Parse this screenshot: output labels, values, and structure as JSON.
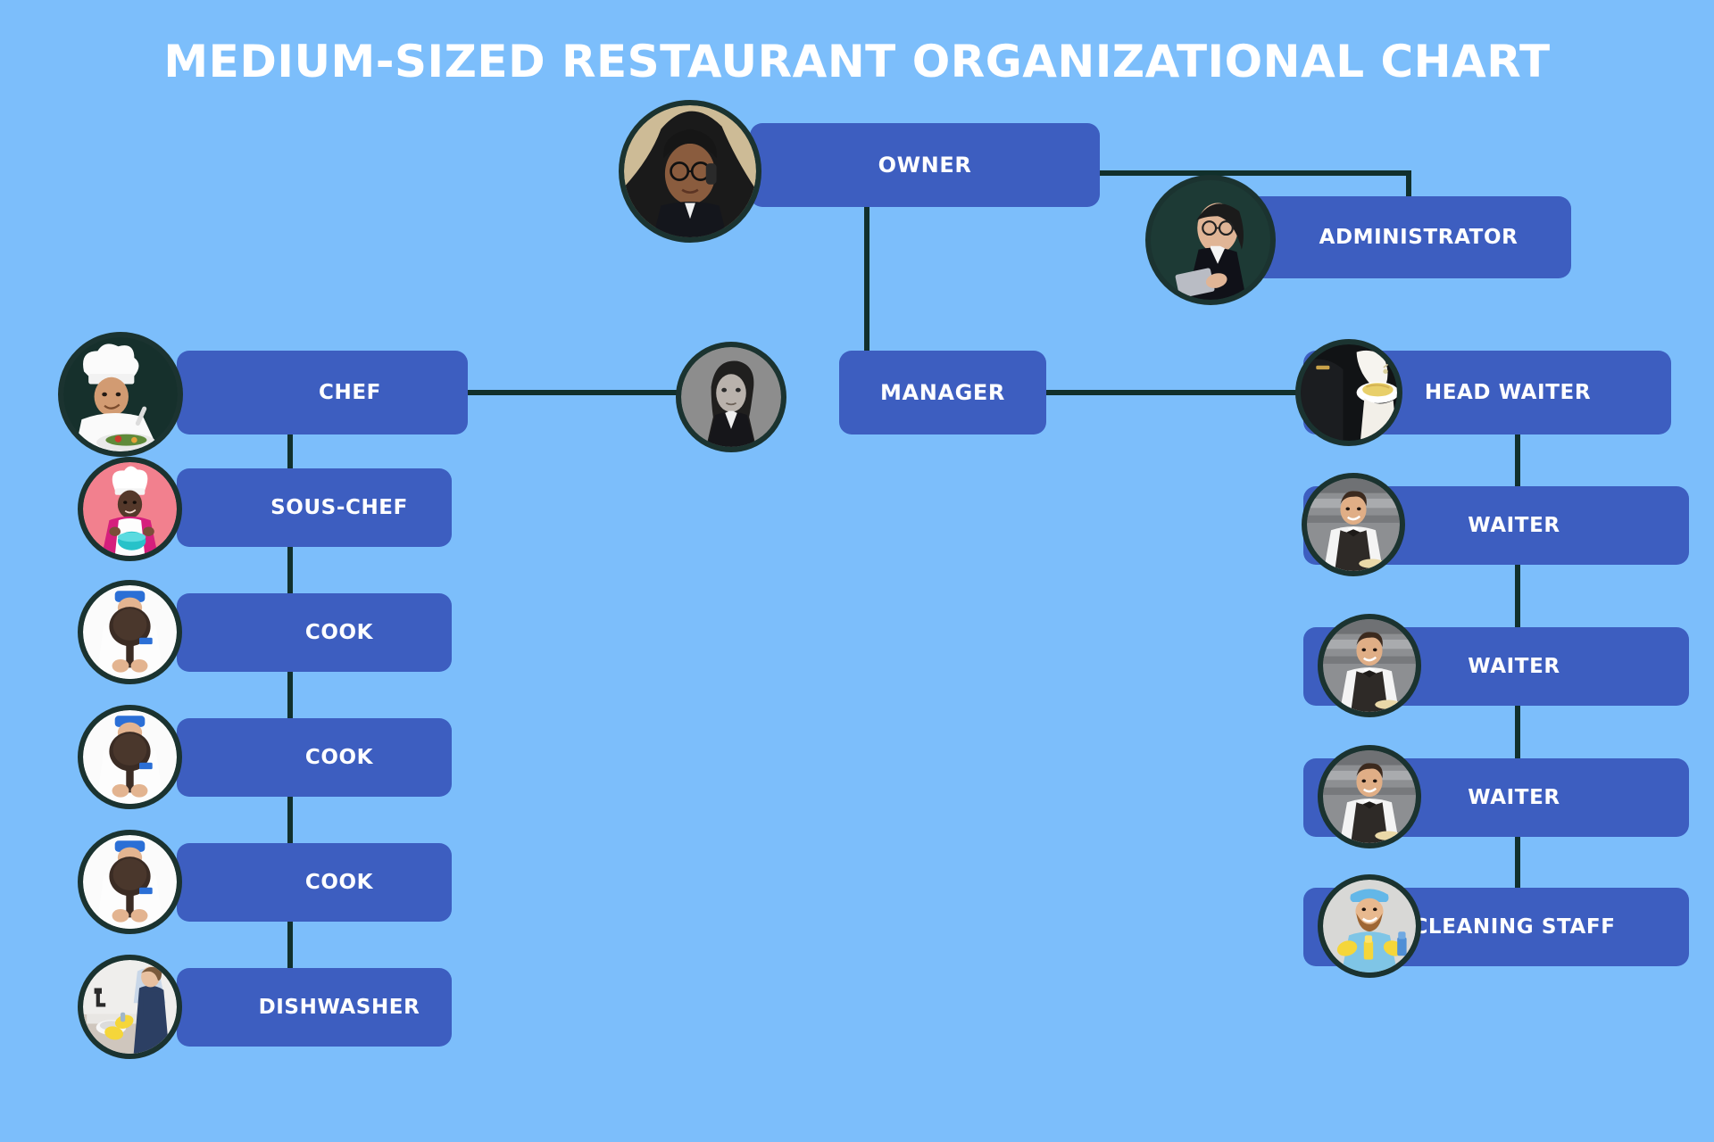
{
  "title": "MEDIUM-SIZED RESTAURANT ORGANIZATIONAL CHART",
  "colors": {
    "background": "#7cbefb",
    "node_fill": "#3d5ec0",
    "connector": "#11302c",
    "label_text": "#ffffff",
    "avatar_ring": "#1b3330"
  },
  "chart_data": {
    "type": "diagram",
    "diagram_kind": "organizational-chart",
    "title": "MEDIUM-SIZED RESTAURANT ORGANIZATIONAL CHART",
    "nodes": [
      {
        "id": "owner",
        "label": "OWNER",
        "level": 0,
        "avatar": "woman-curly-hair-glasses-phone-portrait"
      },
      {
        "id": "administrator",
        "label": "ADMINISTRATOR",
        "level": 1,
        "avatar": "woman-glasses-tablet-portrait"
      },
      {
        "id": "manager",
        "label": "MANAGER",
        "level": 1,
        "avatar": "woman-dark-hair-blazer-bw-portrait"
      },
      {
        "id": "chef",
        "label": "CHEF",
        "level": 2,
        "avatar": "chef-white-hat-plating-dish"
      },
      {
        "id": "sous-chef",
        "label": "SOUS-CHEF",
        "level": 3,
        "avatar": "chef-pink-background-bowl"
      },
      {
        "id": "cook-1",
        "label": "COOK",
        "level": 3,
        "avatar": "cook-holding-frying-pan"
      },
      {
        "id": "cook-2",
        "label": "COOK",
        "level": 3,
        "avatar": "cook-holding-frying-pan"
      },
      {
        "id": "cook-3",
        "label": "COOK",
        "level": 3,
        "avatar": "cook-holding-frying-pan"
      },
      {
        "id": "dishwasher",
        "label": "DISHWASHER",
        "level": 3,
        "avatar": "person-yellow-gloves-washing-sink"
      },
      {
        "id": "head-waiter",
        "label": "HEAD WAITER",
        "level": 2,
        "avatar": "waiter-dark-suit-serving-plate"
      },
      {
        "id": "waiter-1",
        "label": "WAITER",
        "level": 3,
        "avatar": "waiter-bowtie-vest-smiling"
      },
      {
        "id": "waiter-2",
        "label": "WAITER",
        "level": 3,
        "avatar": "waiter-bowtie-vest-smiling"
      },
      {
        "id": "waiter-3",
        "label": "WAITER",
        "level": 3,
        "avatar": "waiter-bowtie-vest-smiling"
      },
      {
        "id": "cleaning-staff",
        "label": "CLEANING STAFF",
        "level": 3,
        "avatar": "cleaner-beard-yellow-gloves-spray"
      }
    ],
    "edges": [
      {
        "from": "owner",
        "to": "administrator"
      },
      {
        "from": "owner",
        "to": "manager"
      },
      {
        "from": "manager",
        "to": "chef"
      },
      {
        "from": "manager",
        "to": "head-waiter"
      },
      {
        "from": "chef",
        "to": "sous-chef"
      },
      {
        "from": "chef",
        "to": "cook-1"
      },
      {
        "from": "chef",
        "to": "cook-2"
      },
      {
        "from": "chef",
        "to": "cook-3"
      },
      {
        "from": "chef",
        "to": "dishwasher"
      },
      {
        "from": "head-waiter",
        "to": "waiter-1"
      },
      {
        "from": "head-waiter",
        "to": "waiter-2"
      },
      {
        "from": "head-waiter",
        "to": "waiter-3"
      },
      {
        "from": "head-waiter",
        "to": "cleaning-staff"
      }
    ]
  },
  "nodes": {
    "owner": {
      "label": "OWNER"
    },
    "administrator": {
      "label": "ADMINISTRATOR"
    },
    "manager": {
      "label": "MANAGER"
    },
    "chef": {
      "label": "CHEF"
    },
    "sous_chef": {
      "label": "SOUS-CHEF"
    },
    "cook_1": {
      "label": "COOK"
    },
    "cook_2": {
      "label": "COOK"
    },
    "cook_3": {
      "label": "COOK"
    },
    "dishwasher": {
      "label": "DISHWASHER"
    },
    "head_waiter": {
      "label": "HEAD WAITER"
    },
    "waiter_1": {
      "label": "WAITER"
    },
    "waiter_2": {
      "label": "WAITER"
    },
    "waiter_3": {
      "label": "WAITER"
    },
    "cleaning_staff": {
      "label": "CLEANING STAFF"
    }
  }
}
